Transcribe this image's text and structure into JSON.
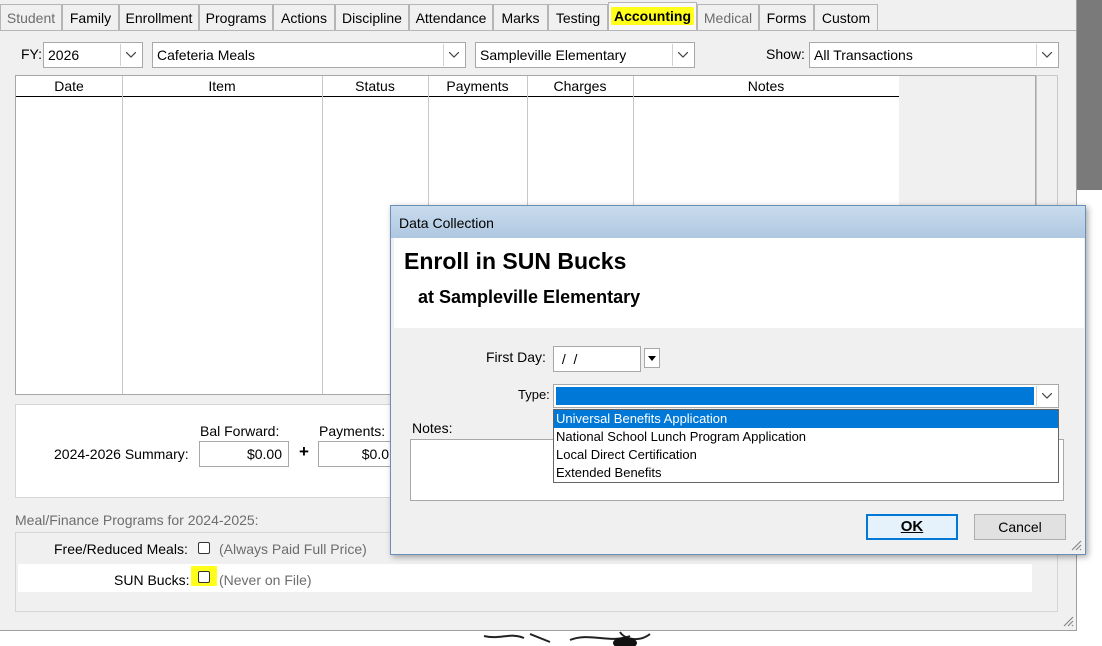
{
  "tabs": [
    {
      "label": "Student",
      "dim": true
    },
    {
      "label": "Family",
      "dim": false
    },
    {
      "label": "Enrollment",
      "dim": false
    },
    {
      "label": "Programs",
      "dim": false
    },
    {
      "label": "Actions",
      "dim": false
    },
    {
      "label": "Discipline",
      "dim": false
    },
    {
      "label": "Attendance",
      "dim": false
    },
    {
      "label": "Marks",
      "dim": false
    },
    {
      "label": "Testing",
      "dim": false
    },
    {
      "label": "Accounting",
      "active": true
    },
    {
      "label": "Medical",
      "dim": true
    },
    {
      "label": "Forms",
      "dim": false
    },
    {
      "label": "Custom",
      "dim": false
    }
  ],
  "filters": {
    "fy_label": "FY:",
    "fy_value": "2026",
    "program_value": "Cafeteria Meals",
    "school_value": "Sampleville Elementary",
    "show_label": "Show:",
    "show_value": "All Transactions"
  },
  "grid": {
    "columns": [
      "Date",
      "Item",
      "Status",
      "Payments",
      "Charges",
      "Notes"
    ]
  },
  "summary": {
    "row_label": "2024-2026 Summary:",
    "bal_forward_label": "Bal Forward:",
    "bal_forward_value": "$0.00",
    "plus": "+",
    "payments_label": "Payments:",
    "payments_value": "$0.0"
  },
  "programs": {
    "section_label": "Meal/Finance Programs for 2024-2025:",
    "free_reduced_label": "Free/Reduced Meals:",
    "free_reduced_note": "(Always Paid Full Price)",
    "sun_bucks_label": "SUN Bucks:",
    "sun_bucks_note": "(Never on File)"
  },
  "dialog": {
    "title": "Data Collection",
    "heading": "Enroll in SUN Bucks",
    "subheading": "at Sampleville Elementary",
    "first_day_label": "First Day:",
    "first_day_value": " /  /",
    "type_label": "Type:",
    "type_value": "",
    "notes_label": "Notes:",
    "type_options": [
      "Universal Benefits Application",
      "National School Lunch Program Application",
      "Local Direct Certification",
      "Extended Benefits"
    ],
    "ok_label": "OK",
    "cancel_label": "Cancel"
  },
  "colors": {
    "highlight": "#ffff1a",
    "selection": "#0078d7"
  }
}
